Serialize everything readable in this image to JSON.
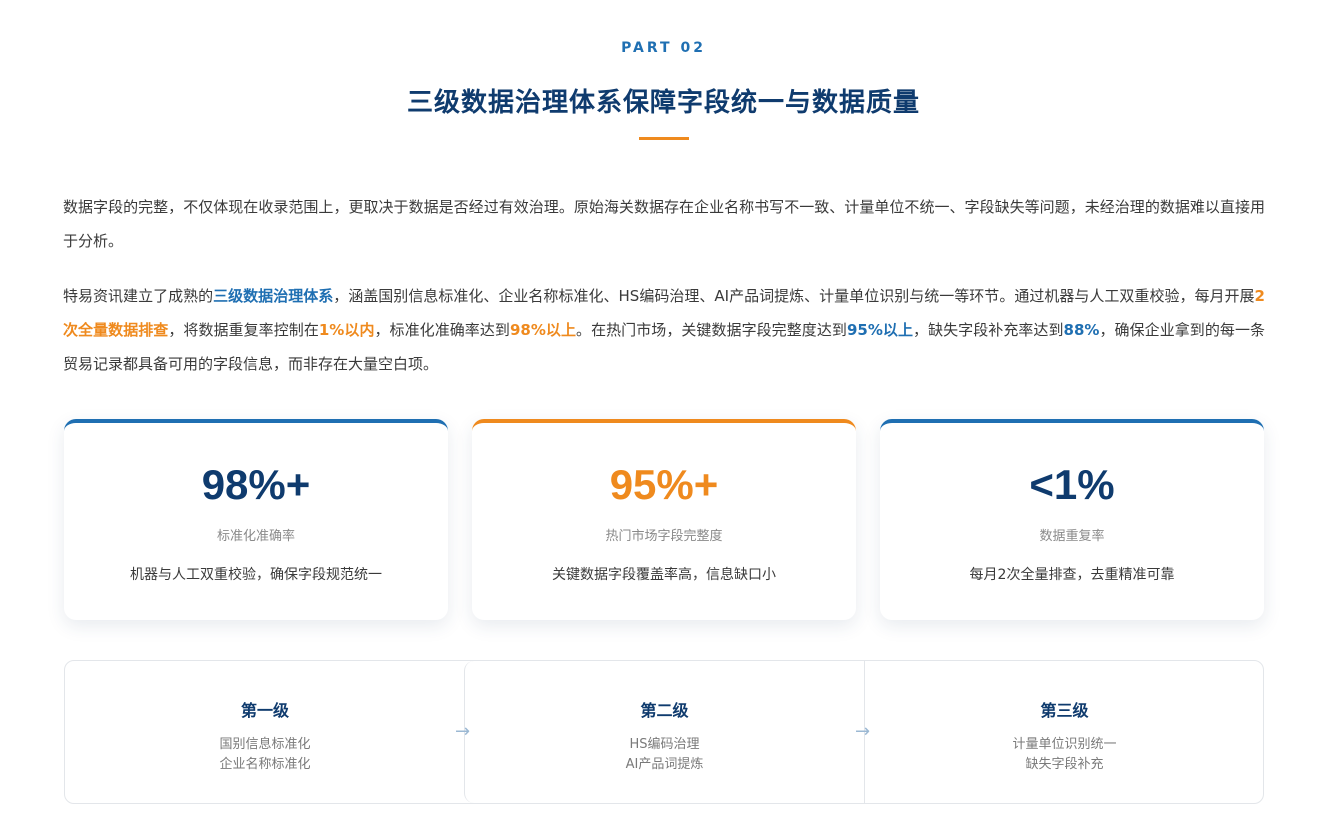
{
  "header": {
    "eyebrow": "PART 02",
    "title": "三级数据治理体系保障字段统一与数据质量"
  },
  "paragraph1": {
    "text": "数据字段的完整，不仅体现在收录范围上，更取决于数据是否经过有效治理。原始海关数据存在企业名称书写不一致、计量单位不统一、字段缺失等问题，未经治理的数据难以直接用于分析。"
  },
  "paragraph2": {
    "t1": "特易资讯建立了成熟的",
    "h1": "三级数据治理体系",
    "t2": "，涵盖国别信息标准化、企业名称标准化、HS编码治理、AI产品词提炼、计量单位识别与统一等环节。通过机器与人工双重校验，每月开展",
    "h2": "2次全量数据排查",
    "t3": "，将数据重复率控制在",
    "h3": "1%以内",
    "t4": "，标准化准确率达到",
    "h4": "98%以上",
    "t5": "。在热门市场，关键数据字段完整度达到",
    "h5": "95%以上",
    "t6": "，缺失字段补充率达到",
    "h6": "88%",
    "t7": "，确保企业拿到的每一条贸易记录都具备可用的字段信息，而非存在大量空白项。"
  },
  "stats": [
    {
      "value": "98%+",
      "label": "标准化准确率",
      "desc": "机器与人工双重校验，确保字段规范统一",
      "accent": "#1f6fb2"
    },
    {
      "value": "95%+",
      "label": "热门市场字段完整度",
      "desc": "关键数据字段覆盖率高，信息缺口小",
      "accent": "#ef8a1e"
    },
    {
      "value": "<1%",
      "label": "数据重复率",
      "desc": "每月2次全量排查，去重精准可靠",
      "accent": "#1f6fb2"
    }
  ],
  "levels": [
    {
      "name": "第一级",
      "items": [
        "国别信息标准化",
        "企业名称标准化"
      ]
    },
    {
      "name": "第二级",
      "items": [
        "HS编码治理",
        "AI产品词提炼"
      ]
    },
    {
      "name": "第三级",
      "items": [
        "计量单位识别统一",
        "缺失字段补充"
      ]
    }
  ],
  "arrow_glyph": "→"
}
